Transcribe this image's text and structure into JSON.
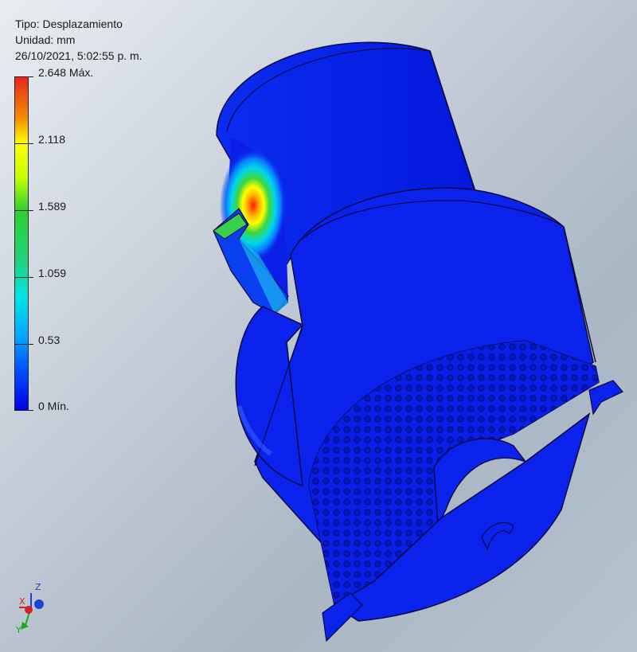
{
  "result_info": {
    "type_line": "Tipo: Desplazamiento",
    "unit_line": "Unidad: mm",
    "timestamp_line": "26/10/2021, 5:02:55 p. m."
  },
  "legend": {
    "max_label": "2.648 Máx.",
    "labels": [
      "2.118",
      "1.589",
      "1.059",
      "0.53"
    ],
    "min_label": "0 Mín.",
    "values": [
      2.648,
      2.118,
      1.589,
      1.059,
      0.53,
      0
    ],
    "colors": {
      "max": "#e8261a",
      "mid_high": "#ffff00",
      "mid": "#2ed12e",
      "mid_low": "#00e5e5",
      "min": "#0000e8"
    }
  },
  "view_triad": {
    "x_label": "X",
    "y_label": "Y",
    "z_label": "Z",
    "x_color": "#d61f1f",
    "y_color": "#1fa51f",
    "z_color": "#1f3fd6"
  },
  "model": {
    "body_color": "#0a1ee8",
    "edge_color": "#0a0a40",
    "hotspot_color": "#ff2a00"
  }
}
